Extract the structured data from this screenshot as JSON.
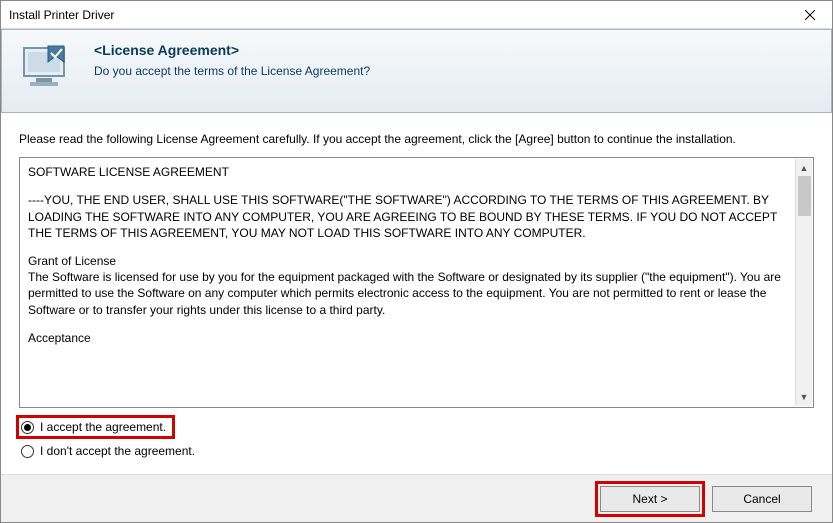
{
  "window": {
    "title": "Install Printer Driver"
  },
  "header": {
    "title": "<License Agreement>",
    "subtitle": "Do you accept the terms of the License Agreement?"
  },
  "instructions": "Please read the following License Agreement carefully. If you accept the agreement, click the [Agree] button to continue the installation.",
  "license": {
    "heading": "SOFTWARE LICENSE AGREEMENT",
    "para1": "----YOU, THE END USER, SHALL USE THIS SOFTWARE(\"THE SOFTWARE\") ACCORDING TO THE TERMS OF THIS AGREEMENT. BY LOADING THE SOFTWARE INTO ANY COMPUTER, YOU ARE AGREEING TO BE BOUND BY THESE TERMS. IF YOU DO NOT ACCEPT THE TERMS OF THIS AGREEMENT, YOU MAY NOT LOAD THIS SOFTWARE INTO ANY COMPUTER.",
    "grant_heading": "Grant of License",
    "grant_body": "The Software is licensed for use by you for the equipment packaged with the Software or designated by its supplier (\"the equipment\"). You are permitted to use the Software on any computer which permits electronic access to the equipment. You are not permitted to rent or lease the Software or to transfer your rights under this license to a third party.",
    "acceptance_heading": "Acceptance"
  },
  "radios": {
    "accept": "I accept the agreement.",
    "decline": "I don't accept the agreement.",
    "selected": "accept"
  },
  "buttons": {
    "next": "Next >",
    "cancel": "Cancel"
  }
}
